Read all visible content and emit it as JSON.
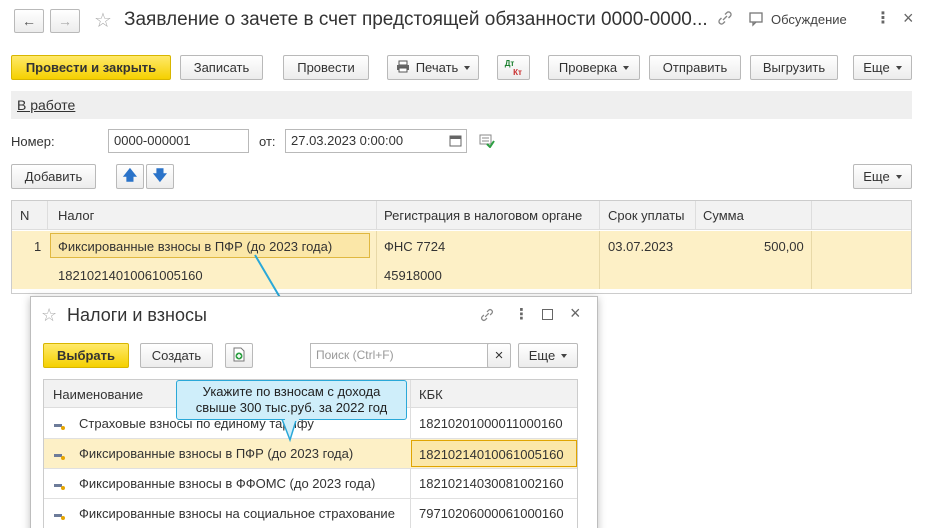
{
  "window": {
    "title": "Заявление о зачете в счет предстоящей обязанности 0000-0000...",
    "discussion": "Обсуждение"
  },
  "toolbar": {
    "post_close": "Провести и закрыть",
    "save": "Записать",
    "post": "Провести",
    "print": "Печать",
    "dt": "Дт",
    "kt": "Кт",
    "check": "Проверка",
    "send": "Отправить",
    "upload": "Выгрузить",
    "more": "Еще"
  },
  "status_link": "В работе",
  "form": {
    "number_label": "Номер:",
    "number_value": "0000-000001",
    "date_label": "от:",
    "date_value": "27.03.2023  0:00:00"
  },
  "table_toolbar": {
    "add": "Добавить",
    "more": "Еще"
  },
  "table": {
    "headers": [
      "N",
      "Налог",
      "Регистрация в налоговом органе",
      "Срок уплаты",
      "Сумма"
    ],
    "row": {
      "n": "1",
      "tax": "Фиксированные взносы в ПФР (до 2023 года)",
      "kbk": "18210214010061005160",
      "registration": "ФНС 7724",
      "oktmo": "45918000",
      "due_date": "03.07.2023",
      "amount": "500,00"
    }
  },
  "dialog": {
    "title": "Налоги и взносы",
    "select": "Выбрать",
    "create": "Создать",
    "search_placeholder": "Поиск (Ctrl+F)",
    "clear": "×",
    "more": "Еще",
    "col_name": "Наименование",
    "col_kbk": "КБК",
    "items": [
      {
        "name": "Страховые взносы по единому тарифу",
        "kbk": "18210201000011000160"
      },
      {
        "name": "Фиксированные взносы в ПФР (до 2023 года)",
        "kbk": "18210214010061005160"
      },
      {
        "name": "Фиксированные взносы в ФФОМС (до 2023 года)",
        "kbk": "18210214030081002160"
      },
      {
        "name": "Фиксированные взносы на социальное страхование",
        "kbk": "79710206000061000160"
      }
    ]
  },
  "tooltip": {
    "line1": "Укажите по взносам с дохода",
    "line2": "свыше 300 тыс.руб. за 2022 год"
  },
  "colors": {
    "accent_yellow": "#f5d000",
    "selected_row": "#fdf0c6",
    "tooltip_bg": "#cfeefa",
    "tooltip_border": "#2aa8d8",
    "arrow": "#2aa8d8"
  }
}
